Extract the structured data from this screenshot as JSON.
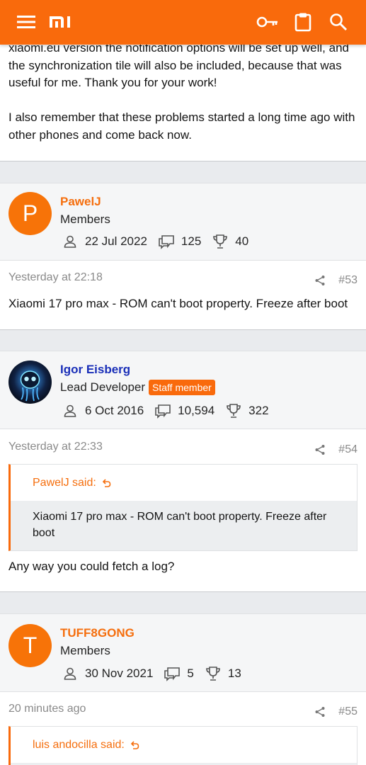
{
  "topbar": {
    "menu_icon": "hamburger-menu-icon",
    "logo_text": "mi",
    "key_icon": "key-icon",
    "clipboard_icon": "clipboard-icon",
    "search_icon": "search-icon",
    "accent": "#f96a0c"
  },
  "previous_post": {
    "line1": "xiaomi.eu version the notification options will be set up well, and the synchronization tile will also be included, because that was useful for me. Thank you for your work!",
    "line2": "I also remember that these problems started a long time ago with other phones and come back now."
  },
  "posts": [
    {
      "avatar_letter": "P",
      "username": "PawelJ",
      "user_title": "Members",
      "joined": "22 Jul 2022",
      "messages": "125",
      "reaction_score": "40",
      "time": "Yesterday at 22:18",
      "number": "#53",
      "body": "Xiaomi 17 pro max - ROM can't boot property. Freeze after boot"
    },
    {
      "avatar_letter": "",
      "username": "Igor Eisberg",
      "user_title": "Lead Developer",
      "badge": "Staff member",
      "joined": "6 Oct 2016",
      "messages": "10,594",
      "reaction_score": "322",
      "time": "Yesterday at 22:33",
      "number": "#54",
      "quote_author": "PawelJ said:",
      "quote_text": "Xiaomi 17 pro max - ROM can't boot property. Freeze after boot",
      "body": "Any way you could fetch a log?"
    },
    {
      "avatar_letter": "T",
      "username": "TUFF8GONG",
      "user_title": "Members",
      "joined": "30 Nov 2021",
      "messages": "5",
      "reaction_score": "13",
      "time": "20 minutes ago",
      "number": "#55",
      "quote_author": "luis andocilla said:"
    }
  ]
}
